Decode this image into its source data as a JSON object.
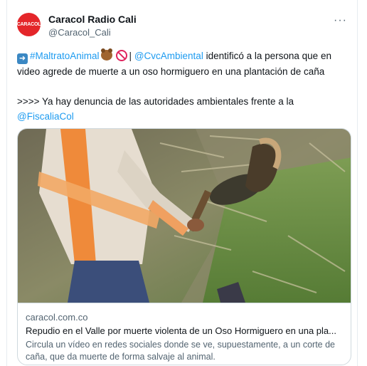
{
  "account": {
    "avatar_text": "CARACOL",
    "name": "Caracol Radio Cali",
    "handle": "@Caracol_Cali",
    "brand_color": "#e4262a"
  },
  "menu": {
    "more_label": "···"
  },
  "tweet": {
    "hashtag": "#MaltratoAnimal",
    "separator": "|",
    "mention": "@CvcAmbiental",
    "line1_rest": " identificó a la persona que en",
    "line2": "video agrede de muerte a un oso hormiguero en una plantación de caña",
    "line3": ">>>> Ya hay denuncia de las autoridades ambientales  frente a la",
    "mention2": "@FiscaliaCol",
    "emoji": [
      "right-arrow-icon",
      "bear-icon",
      "prohibited-icon"
    ],
    "link_color": "#1d9bf0"
  },
  "card": {
    "domain": "caracol.com.co",
    "title": "Repudio en el Valle por muerte violenta de un Oso Hormiguero en una pla...",
    "description": "Circula un vídeo en redes sociales donde se ve, supuestamente, a un corte de caña, que da muerte de forma salvaje al animal."
  }
}
